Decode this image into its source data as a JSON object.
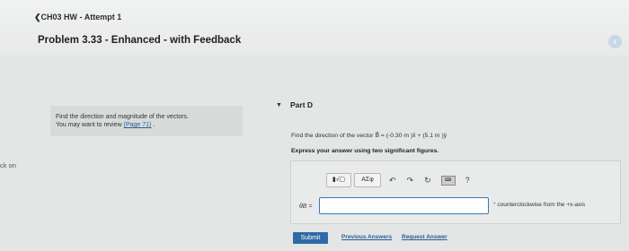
{
  "header": {
    "breadcrumb": "❮CH03 HW - Attempt 1",
    "problem_title": "Problem 3.33 - Enhanced - with Feedback",
    "collapse_icon": "‹"
  },
  "left_panel": {
    "instruction_line1": "Find the direction and magnitude of the vectors.",
    "instruction_line2_prefix": "You may want to review ",
    "review_link": "(Page 71)",
    "instruction_line2_suffix": " ."
  },
  "side_text": "ck on",
  "part": {
    "caret_icon": "▼",
    "title": "Part D",
    "question": "Find the direction of the vector B⃗ = (-0.30 m )x̂ + (5.1 m )ŷ",
    "instruction": "Express your answer using two significant figures."
  },
  "toolbar": {
    "template_btn": "▮√▢",
    "greek_btn": "ΑΣφ",
    "undo_icon": "↶",
    "redo_icon": "↷",
    "reset_icon": "↻",
    "keyboard_icon": "⌨",
    "help_icon": "?"
  },
  "answer": {
    "label": "θB =",
    "value": "",
    "unit_text": "° counterclockwise from the +x-axis"
  },
  "actions": {
    "submit": "Submit",
    "previous_answers": "Previous Answers",
    "request_answer": "Request Answer"
  }
}
